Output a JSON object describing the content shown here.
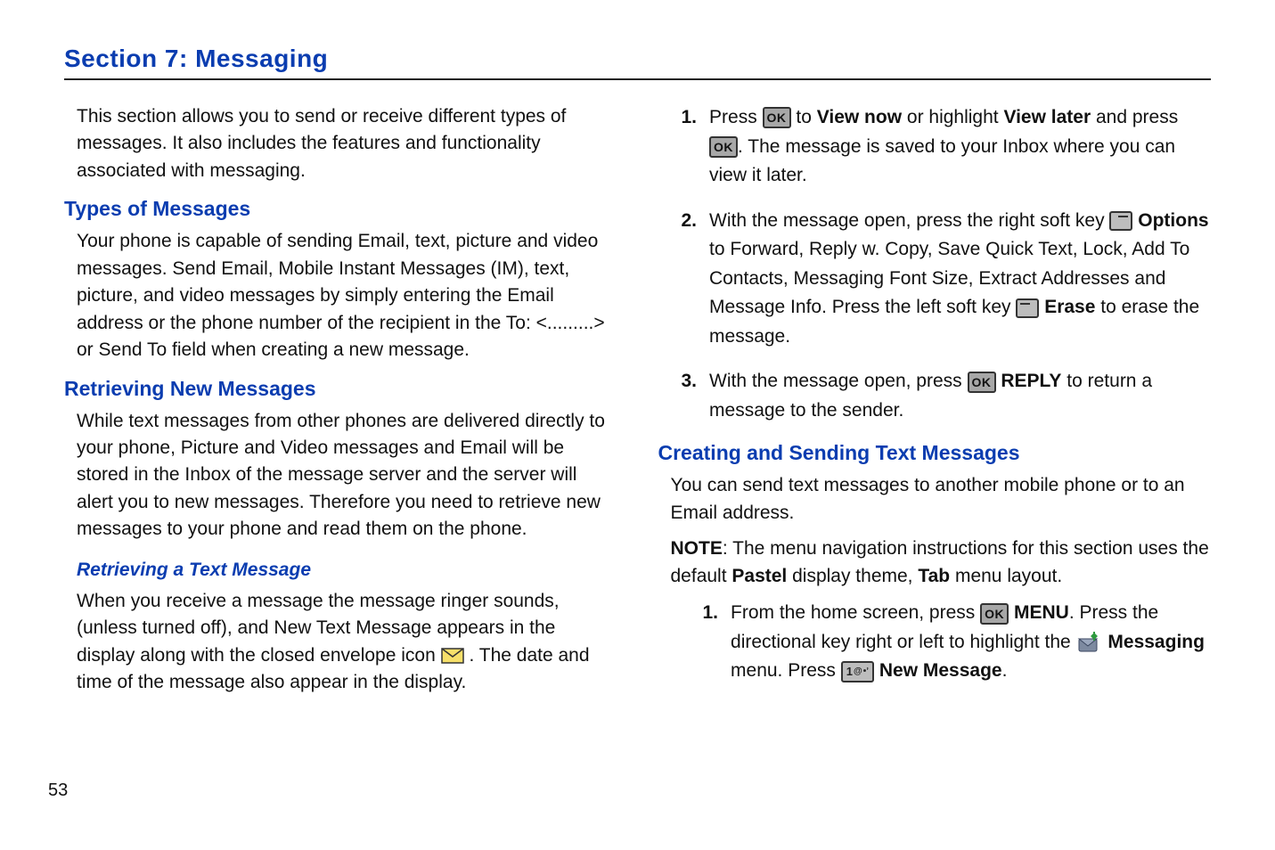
{
  "section_title": "Section 7:  Messaging",
  "page_number": "53",
  "left": {
    "intro": "This section allows you to send or receive different types of messages. It also includes the features and functionality associated with messaging.",
    "types_heading": "Types of Messages",
    "types_body": "Your phone is capable of sending Email, text, picture and video messages. Send Email, Mobile Instant Messages (IM), text, picture, and video messages by simply entering the Email address or the phone number of the recipient in the To: <.........> or Send To field when creating a new message.",
    "retrieving_heading": "Retrieving New Messages",
    "retrieving_body": "While text messages from other phones are delivered directly to your phone, Picture and Video messages and Email will be stored in the Inbox of the message server and the server will alert you to new messages. Therefore you need to retrieve new messages to your phone and read them on the phone.",
    "retrieving_text_heading": "Retrieving a Text Message",
    "retrieving_text_body_a": "When you receive a message the message ringer sounds, (unless turned off), and New Text Message appears in the display along with the closed envelope icon ",
    "retrieving_text_body_b": " . The date and time of the message also appear in the display."
  },
  "right": {
    "step1_num": "1.",
    "step1_a": "Press ",
    "step1_b": " to ",
    "step1_view_now": "View now",
    "step1_c": " or highlight ",
    "step1_view_later": "View later",
    "step1_d": " and press ",
    "step1_e": ". The message is saved to your Inbox where you can view it later.",
    "step2_num": "2.",
    "step2_a": "With the message open, press the right soft key ",
    "step2_options": "Options",
    "step2_b": " to Forward, Reply w. Copy, Save Quick Text, Lock, Add To Contacts, Messaging Font Size, Extract Addresses and Message Info. Press the left soft key ",
    "step2_erase": "Erase",
    "step2_c": " to erase the message.",
    "step3_num": "3.",
    "step3_a": "With the message open, press ",
    "step3_reply": "REPLY",
    "step3_b": " to return a message to the sender.",
    "creating_heading": "Creating and Sending Text Messages",
    "creating_body1": "You can send text messages to another mobile phone or to an Email address.",
    "note_label": "NOTE",
    "note_a": ": The menu navigation instructions for this section uses the default ",
    "note_pastel": "Pastel",
    "note_b": " display theme, ",
    "note_tab": "Tab",
    "note_c": " menu layout.",
    "c_step1_num": "1.",
    "c_step1_a": "From the home screen, press ",
    "c_step1_menu": "MENU",
    "c_step1_b": ". Press the directional key right or left to highlight the ",
    "c_step1_messaging": "Messaging",
    "c_step1_c": " menu. Press ",
    "c_step1_new_message": "New Message",
    "c_step1_d": "."
  },
  "keys": {
    "ok": "OK",
    "one": "1 @ •"
  }
}
